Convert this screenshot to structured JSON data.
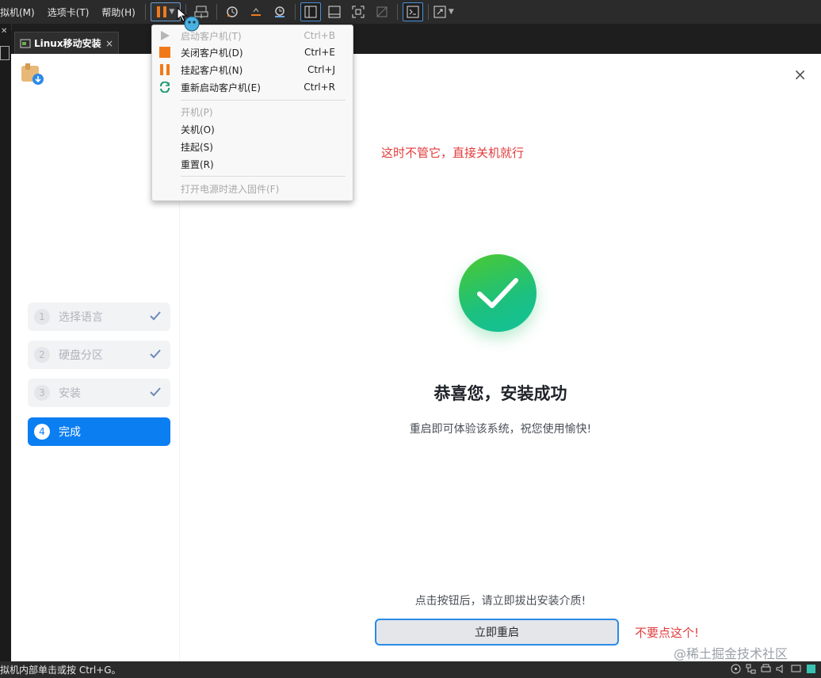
{
  "menubar": {
    "items": [
      "拟机(M)",
      "选项卡(T)",
      "帮助(H)"
    ]
  },
  "toolbar": {
    "icons": [
      "pause-icon",
      "send-ctrl-alt-del-icon",
      "snapshot-icon",
      "revert-snapshot-icon",
      "snapshot-manager-icon",
      "library-view-icon",
      "thumbnail-view-icon",
      "fullscreen-icon",
      "unity-icon",
      "console-icon",
      "stretch-icon"
    ]
  },
  "tab": {
    "label": "Linux移动安装",
    "close": "×"
  },
  "app": {
    "close": "×",
    "steps": [
      {
        "num": "1",
        "label": "选择语言",
        "done": true
      },
      {
        "num": "2",
        "label": "硬盘分区",
        "done": true
      },
      {
        "num": "3",
        "label": "安装",
        "done": true
      },
      {
        "num": "4",
        "label": "完成",
        "done": false
      }
    ],
    "title": "恭喜您，安装成功",
    "subtitle": "重启即可体验该系统，祝您使用愉快!",
    "remove_note": "点击按钮后，请立即拔出安装介质!",
    "reboot_button": "立即重启"
  },
  "annotations": {
    "shutdown_hint": "这时不管它，直接关机就行",
    "dont_click": "不要点这个!"
  },
  "dropdown": {
    "items": [
      {
        "label": "启动客户机(T)",
        "shortcut": "Ctrl+B",
        "disabled": true,
        "icon": "play-icon"
      },
      {
        "label": "关闭客户机(D)",
        "shortcut": "Ctrl+E",
        "disabled": false,
        "icon": "stop-icon"
      },
      {
        "label": "挂起客户机(N)",
        "shortcut": "Ctrl+J",
        "disabled": false,
        "icon": "pause-icon"
      },
      {
        "label": "重新启动客户机(E)",
        "shortcut": "Ctrl+R",
        "disabled": false,
        "icon": "restart-icon"
      },
      {
        "label": "开机(P)",
        "disabled": true
      },
      {
        "label": "关机(O)",
        "disabled": false
      },
      {
        "label": "挂起(S)",
        "disabled": false
      },
      {
        "label": "重置(R)",
        "disabled": false
      },
      {
        "label": "打开电源时进入固件(F)",
        "disabled": true
      }
    ]
  },
  "statusbar": {
    "text": "拟机内部单击或按 Ctrl+G。"
  },
  "watermark": "@稀土掘金技术社区",
  "colors": {
    "accent": "#0b7ef2",
    "success": "#22c26a",
    "annotation": "#e23b3b",
    "pause_orange": "#f07a1a"
  }
}
